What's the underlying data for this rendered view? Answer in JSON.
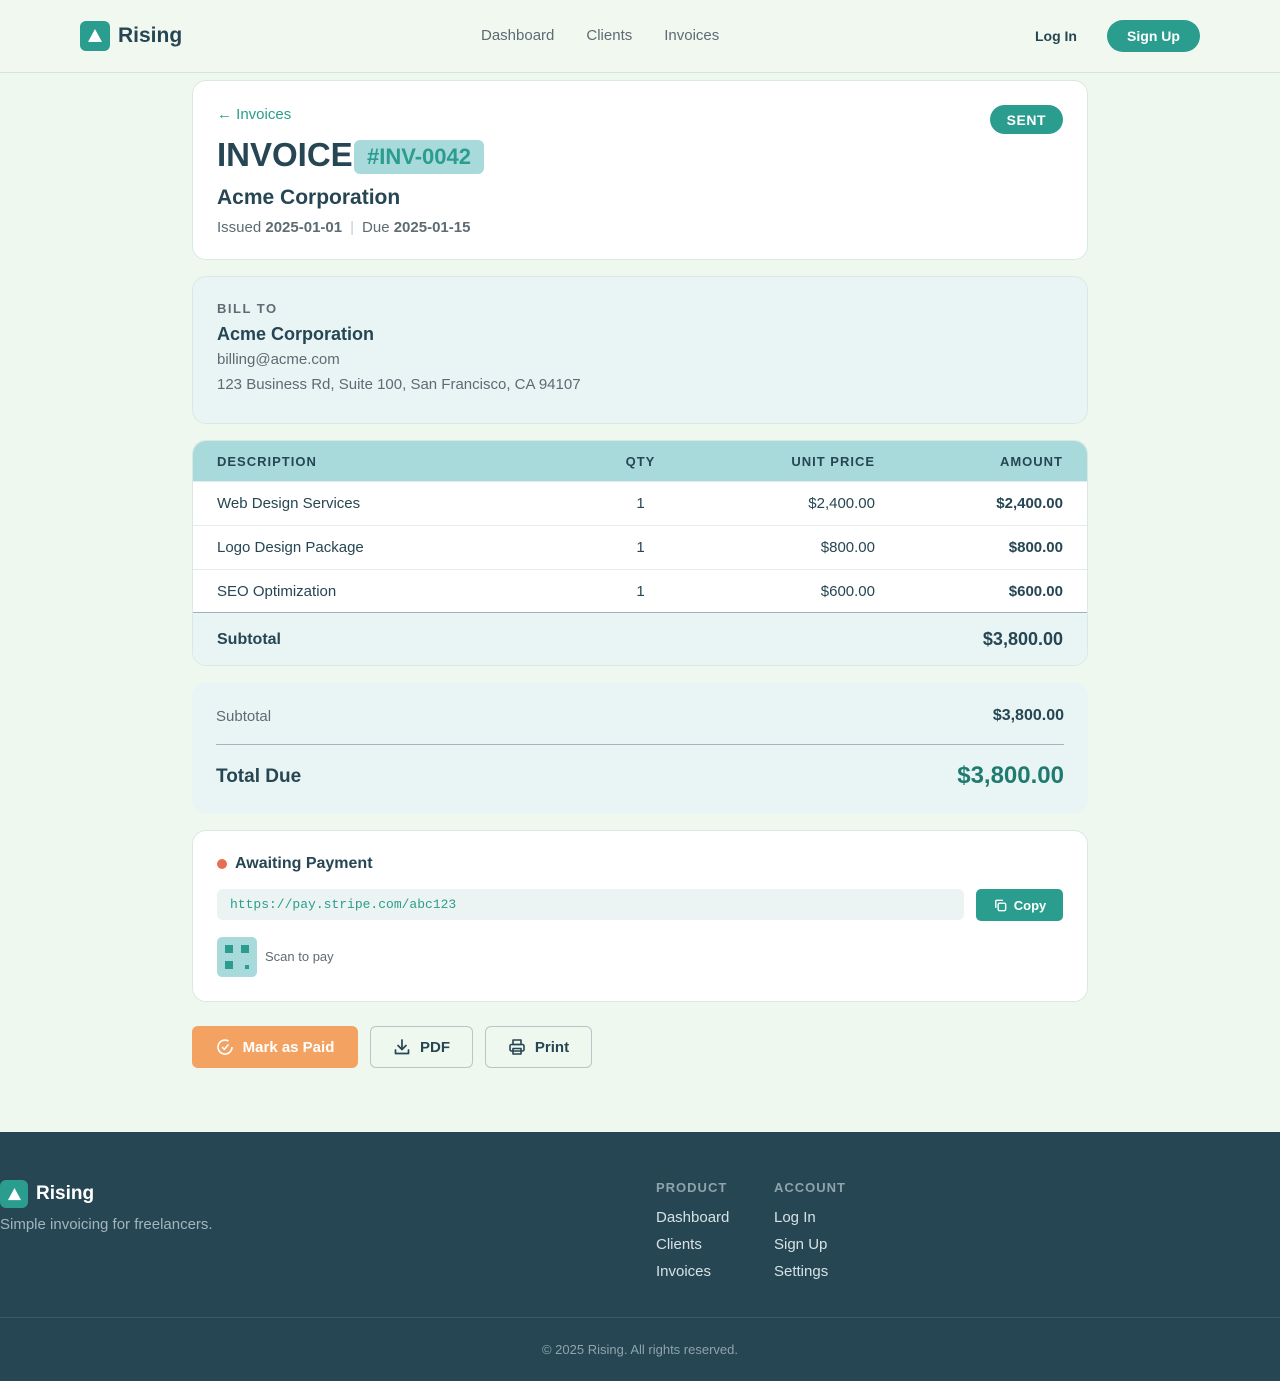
{
  "brand": {
    "name": "Rising",
    "icon": "triangle-logo-icon"
  },
  "nav": {
    "items": [
      "Dashboard",
      "Clients",
      "Invoices"
    ],
    "login": "Log In",
    "signup": "Sign Up"
  },
  "invoice": {
    "back_link": "← Invoices",
    "status": "SENT",
    "title": "INVOICE",
    "number": "#INV-0042",
    "client": "Acme Corporation",
    "issued_label": "Issued",
    "issued_date": "2025-01-01",
    "due_label": "Due",
    "due_date": "2025-01-15"
  },
  "bill_to": {
    "label": "BILL TO",
    "name": "Acme Corporation",
    "email": "billing@acme.com",
    "address": "123 Business Rd, Suite 100, San Francisco, CA 94107"
  },
  "table": {
    "headers": {
      "description": "DESCRIPTION",
      "qty": "QTY",
      "unit_price": "UNIT PRICE",
      "amount": "AMOUNT"
    },
    "rows": [
      {
        "description": "Web Design Services",
        "qty": "1",
        "unit_price": "$2,400.00",
        "amount": "$2,400.00"
      },
      {
        "description": "Logo Design Package",
        "qty": "1",
        "unit_price": "$800.00",
        "amount": "$800.00"
      },
      {
        "description": "SEO Optimization",
        "qty": "1",
        "unit_price": "$600.00",
        "amount": "$600.00"
      }
    ],
    "subtotal_label": "Subtotal",
    "subtotal_value": "$3,800.00"
  },
  "totals": {
    "subtotal_label": "Subtotal",
    "subtotal_value": "$3,800.00",
    "total_label": "Total Due",
    "total_value": "$3,800.00"
  },
  "payment": {
    "status": "Awaiting Payment",
    "link": "https://pay.stripe.com/abc123",
    "copy_label": "Copy",
    "scan_label": "Scan to pay"
  },
  "actions": {
    "mark_paid": "Mark as Paid",
    "pdf": "PDF",
    "print": "Print"
  },
  "footer": {
    "brand": "Rising",
    "tagline": "Simple invoicing for freelancers.",
    "product_heading": "PRODUCT",
    "product_links": [
      "Dashboard",
      "Clients",
      "Invoices"
    ],
    "account_heading": "ACCOUNT",
    "account_links": [
      "Log In",
      "Sign Up",
      "Settings"
    ],
    "copyright": "© 2025 Rising. All rights reserved."
  },
  "colors": {
    "accent": "#2a9d8f",
    "dark": "#264653",
    "warning": "#e76f51",
    "orange": "#f4a261",
    "teal_light": "#a8dadc"
  }
}
